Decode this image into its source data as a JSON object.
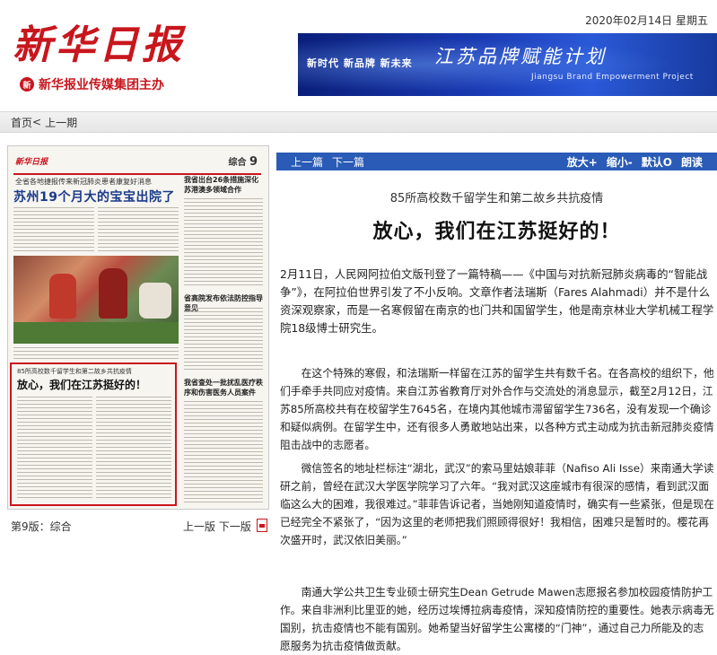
{
  "masthead": {
    "logo": "新华日报",
    "publisher": "新华报业传媒集团主办",
    "seal": "新",
    "date": "2020年02月14日",
    "weekday": "星期五",
    "banner": {
      "slogan": "新时代   新品牌   新未来",
      "title_cn": "江苏品牌赋能计划",
      "title_en": "Jiangsu Brand Empowerment Project"
    }
  },
  "nav": {
    "home": "首页",
    "sep": "<",
    "prev_issue": "上一期"
  },
  "page_thumb": {
    "logo": "新华日报",
    "section": "综合",
    "page_num": "9",
    "kicker": "全省各地捷报传来新冠肺炎患者康复好消息",
    "headline": "苏州19个月大的宝宝出院了",
    "side_title_1": "我省出台26条措施深化苏港澳多领域合作",
    "side_title_2": "省高院发布依法防控指导意见",
    "side_title_3": "我省查处一批扰乱医疗秩序和伤害医务人员案件",
    "hl_kicker": "85所高校数千留学生和第二故乡共抗疫情",
    "hl_head": "放心，我们在江苏挺好的！"
  },
  "page_footer": {
    "page_label": "第9版：综合",
    "prev_next": "上一版  下一版"
  },
  "toolbar": {
    "prev": "上一篇",
    "next": "下一篇",
    "zoom_in": "放大+",
    "zoom_out": "缩小-",
    "default": "默认O",
    "read": "朗读"
  },
  "article": {
    "subtitle": "85所高校数千留学生和第二故乡共抗疫情",
    "headline": "放心，我们在江苏挺好的！",
    "paragraphs": [
      "2月11日，人民网阿拉伯文版刊登了一篇特稿——《中国与对抗新冠肺炎病毒的“智能战争”》，在阿拉伯世界引发了不小反响。文章作者法瑞斯（Fares Alahmadi）并不是什么资深观察家，而是一名寒假留在南京的也门共和国留学生，他是南京林业大学机械工程学院18级博士研究生。",
      "在这个特殊的寒假，和法瑞斯一样留在江苏的留学生共有数千名。在各高校的组织下，他们手牵手共同应对疫情。来自江苏省教育厅对外合作与交流处的消息显示，截至2月12日，江苏85所高校共有在校留学生7645名，在境内其他城市滞留留学生736名，没有发现一个确诊和疑似病例。在留学生中，还有很多人勇敢地站出来，以各种方式主动成为抗击新冠肺炎疫情阻击战中的志愿者。",
      "微信签名的地址栏标注“湖北，武汉”的索马里姑娘菲菲（Nafiso Ali Isse）来南通大学读研之前，曾经在武汉大学医学院学习了六年。“我对武汉这座城市有很深的感情，看到武汉面临这么大的困难，我很难过。”菲菲告诉记者，当她刚知道疫情时，确实有一些紧张，但是现在已经完全不紧张了，“因为这里的老师把我们照顾得很好！我相信，困难只是暂时的。樱花再次盛开时，武汉依旧美丽。”",
      "南通大学公共卫生专业硕士研究生Dean Getrude Mawen志愿报名参加校园疫情防护工作。来自非洲利比里亚的她，经历过埃博拉病毒疫情，深知疫情防控的重要性。她表示病毒无国别，抗击疫情也不能有国别。她希望当好留学生公寓楼的“门神”，通过自己力所能及的志愿服务为抗击疫情做贡献。"
    ]
  },
  "colors": {
    "brand_red": "#c8161d",
    "toolbar_blue": "#2a5bb7",
    "banner_blue": "#1a3bb5"
  }
}
